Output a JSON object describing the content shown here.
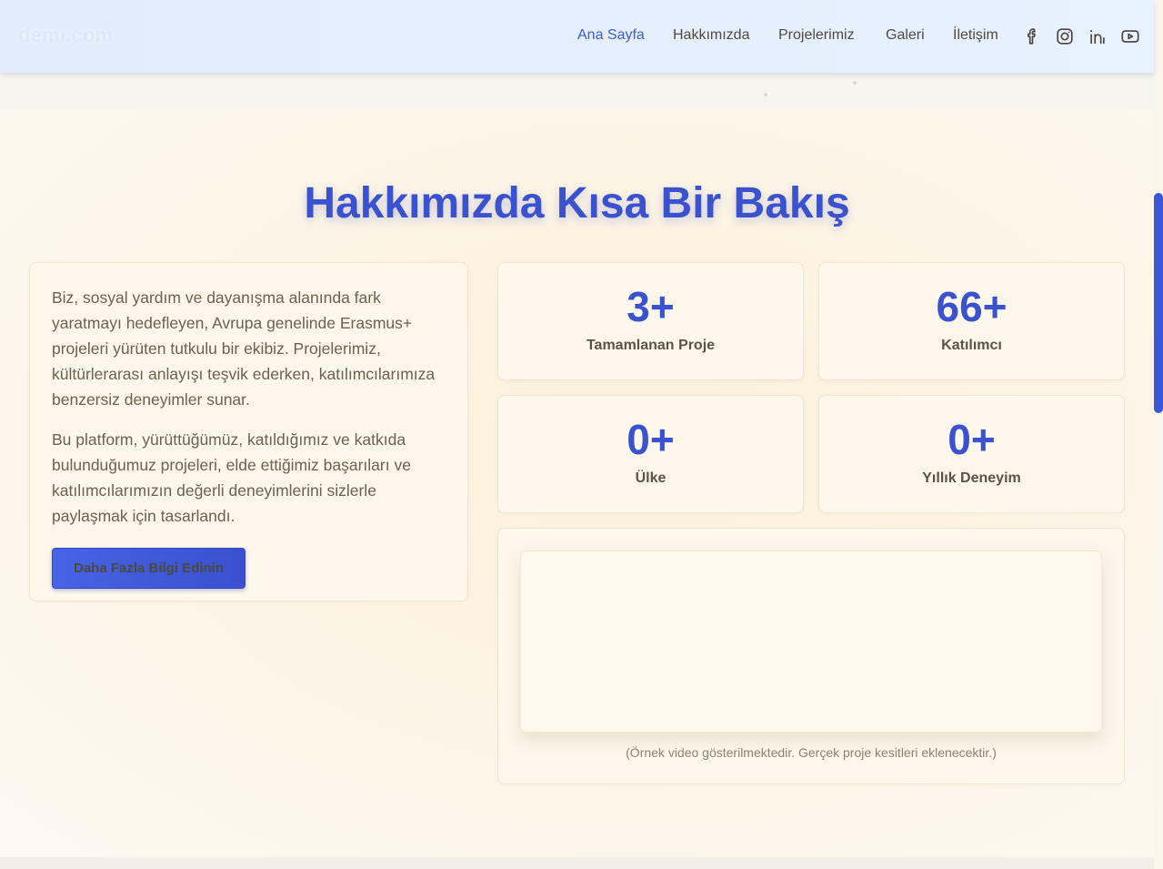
{
  "header": {
    "logo_main": "",
    "logo_tail": "demi.com",
    "nav": [
      {
        "label": "Ana Sayfa",
        "active": true
      },
      {
        "label": "Hakkımızda",
        "active": false
      },
      {
        "label": "Projelerimiz",
        "active": false
      },
      {
        "label": "Galeri",
        "active": false
      },
      {
        "label": "İletişim",
        "active": false
      }
    ],
    "social_icons": [
      "facebook-icon",
      "instagram-icon",
      "linkedin-icon",
      "youtube-icon"
    ]
  },
  "about": {
    "title": "Hakkımızda Kısa Bir Bakış",
    "paragraph1": "Biz, sosyal yardım ve dayanışma alanında fark yaratmayı hedefleyen, Avrupa genelinde Erasmus+ projeleri yürüten tutkulu bir ekibiz. Projelerimiz, kültürlerarası anlayışı teşvik ederken, katılımcılarımıza benzersiz deneyimler sunar.",
    "paragraph2": "Bu platform, yürüttüğümüz, katıldığımız ve katkıda bulunduğumuz projeleri, elde ettiğimiz başarıları ve katılımcılarımızın değerli deneyimlerini sizlerle paylaşmak için tasarlandı.",
    "button_label": "Daha Fazla Bilgi Edinin"
  },
  "stats": [
    {
      "value": "3+",
      "label": "Tamamlanan Proje"
    },
    {
      "value": "66+",
      "label": "Katılımcı"
    },
    {
      "value": "0+",
      "label": "Ülke"
    },
    {
      "value": "0+",
      "label": "Yıllık Deneyim"
    }
  ],
  "video": {
    "caption": "(Örnek video gösterilmektedir. Gerçek proje kesitleri eklenecektir.)"
  },
  "colors": {
    "accent": "#3b52cf",
    "nav_active": "#3f5bd6",
    "background": "#fbf6ec"
  }
}
